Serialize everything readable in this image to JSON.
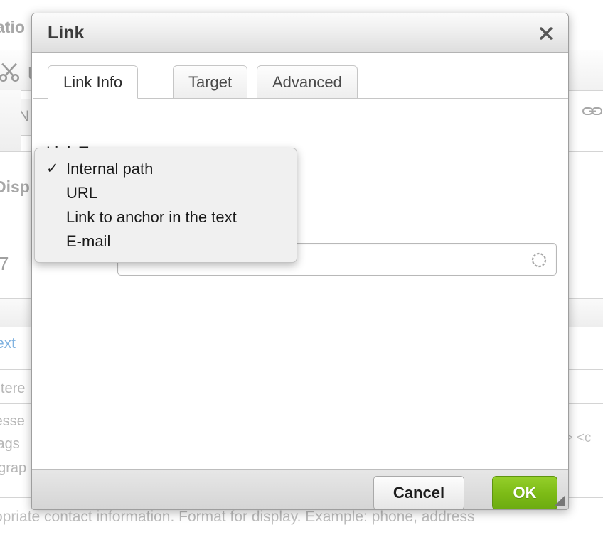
{
  "background": {
    "section_heading": "atio",
    "field_label_partial": "Disp",
    "field_value_partial": "7",
    "toolbar_icons": [
      "cut-icon",
      "copy-icon",
      "unlink-icon",
      "link-icon"
    ],
    "input_partial_text": "N",
    "link_text_partial": "ext",
    "filtered_text_partial": "iltere",
    "address_text_partial": "resse",
    "tags_text_partial": " tags",
    "paragraph_text_partial": "agrap",
    "allowed_tags_partial": "li> <c",
    "help_text": "opriate contact information. Format for display. Example: phone, address"
  },
  "dialog": {
    "title": "Link",
    "close_label": "✕",
    "tabs": [
      {
        "label": "Link Info",
        "active": true
      },
      {
        "label": "Target",
        "active": false
      },
      {
        "label": "Advanced",
        "active": false
      }
    ],
    "link_type": {
      "label": "Link Type",
      "selected": "Internal path",
      "options": [
        {
          "label": "Internal path",
          "selected": true
        },
        {
          "label": "URL",
          "selected": false
        },
        {
          "label": "Link to anchor in the text",
          "selected": false
        },
        {
          "label": "E-mail",
          "selected": false
        }
      ],
      "check_glyph": "✓"
    },
    "url_field": {
      "value": "",
      "placeholder": "",
      "throbber": "autocomplete-throbber-icon"
    },
    "footer": {
      "cancel_label": "Cancel",
      "ok_label": "OK"
    }
  },
  "colors": {
    "ok_button_green": "#7dbb16",
    "dialog_chrome": "#dedede",
    "link_blue": "#7fb2e0",
    "muted_text": "#b6b6b6"
  }
}
